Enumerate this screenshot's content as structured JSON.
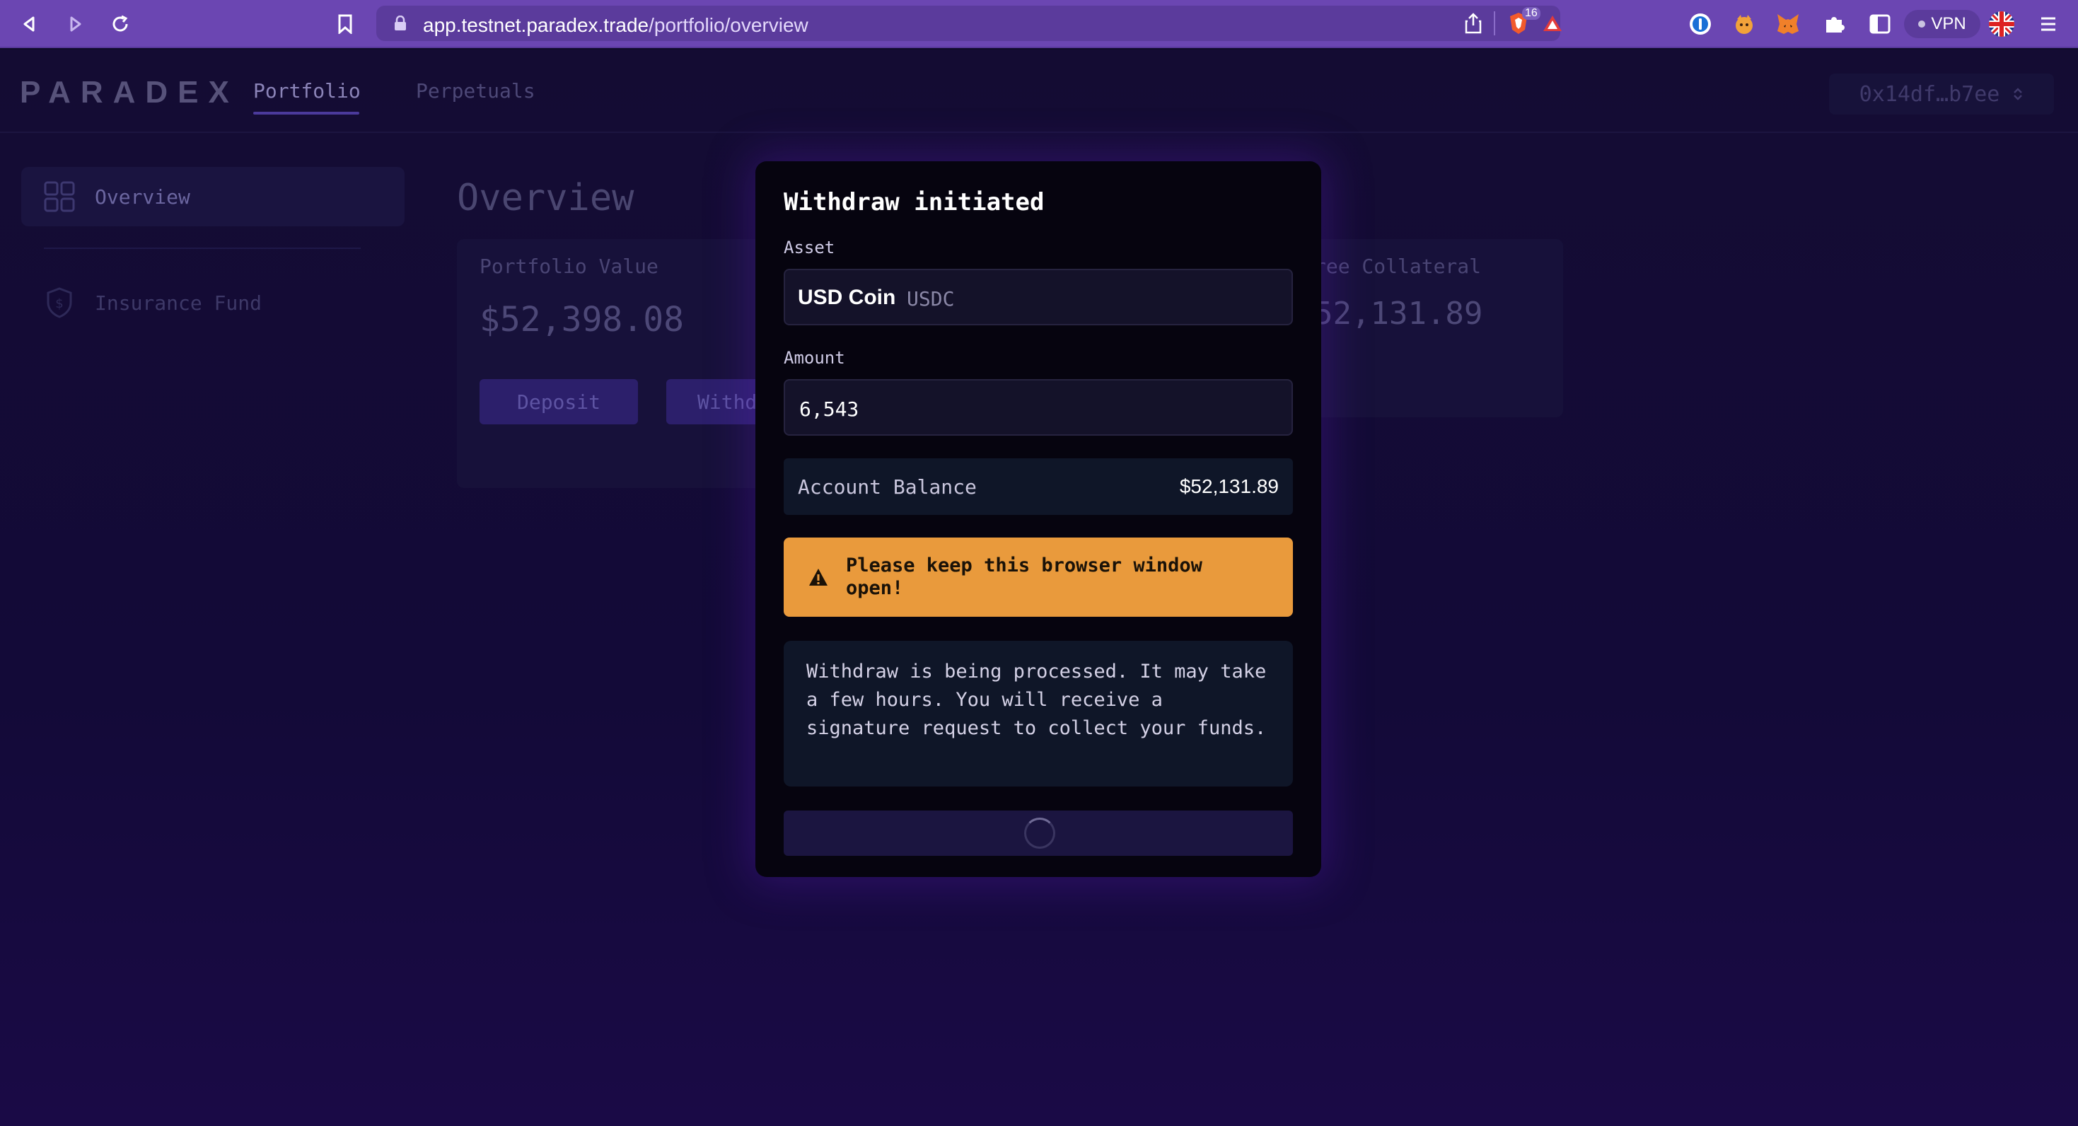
{
  "browser": {
    "url_host": "app.testnet.paradex.trade",
    "url_path": "/portfolio/overview",
    "brave_badge": "16",
    "vpn_label": "VPN"
  },
  "app": {
    "logo": "PARADEX",
    "tabs": [
      {
        "label": "Portfolio",
        "active": true
      },
      {
        "label": "Perpetuals",
        "active": false
      }
    ],
    "wallet": "0x14df…b7ee",
    "sidebar": [
      {
        "label": "Overview",
        "icon": "grid-icon",
        "active": true
      },
      {
        "label": "Insurance Fund",
        "icon": "shield-dollar-icon",
        "active": false
      }
    ],
    "page_title": "Overview",
    "portfolio_card": {
      "label": "Portfolio Value",
      "value": "$52,398.08",
      "deposit_label": "Deposit",
      "withdraw_label": "Withd"
    },
    "collateral_card": {
      "label": "ree Collateral",
      "value": "52,131.89"
    }
  },
  "modal": {
    "title": "Withdraw initiated",
    "asset_label": "Asset",
    "asset_name": "USD Coin",
    "asset_ticker": "USDC",
    "amount_label": "Amount",
    "amount_value": "6,543",
    "balance_label": "Account Balance",
    "balance_value": "$52,131.89",
    "warning": "Please keep this browser window open!",
    "info": "Withdraw is being processed. It may take a few hours. You will receive a signature request to collect your funds."
  },
  "colors": {
    "browser_accent": "#6b46b2",
    "warning": "#e99a3c",
    "modal_bg": "#06040f"
  }
}
